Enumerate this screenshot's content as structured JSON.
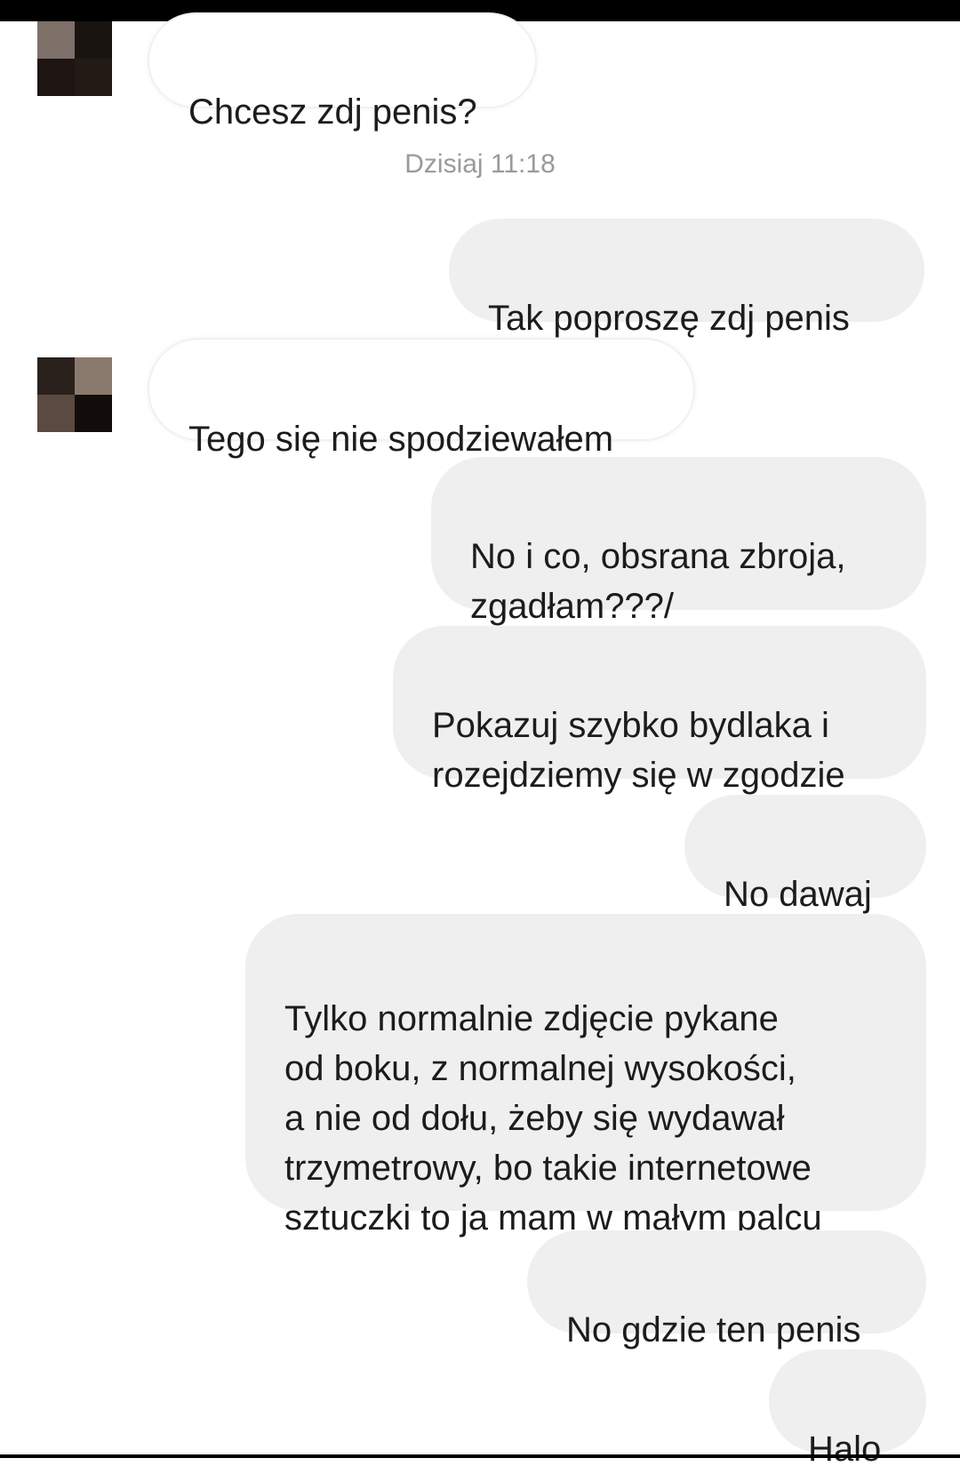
{
  "conversation": {
    "timestamp": "Dzisiaj 11:18",
    "messages": [
      {
        "side": "in",
        "text": "Chcesz zdj penis?"
      },
      {
        "side": "out",
        "text": "Tak poproszę zdj penis"
      },
      {
        "side": "in",
        "text": "Tego się nie spodziewałem"
      },
      {
        "side": "out",
        "text": "No i co, obsrana zbroja,\nzgadłam???/"
      },
      {
        "side": "out",
        "text": "Pokazuj szybko bydlaka i\nrozejdziemy się w zgodzie"
      },
      {
        "side": "out",
        "text": "No dawaj"
      },
      {
        "side": "out",
        "text": "Tylko normalnie zdjęcie pykane\nod boku, z normalnej wysokości,\na nie od dołu, żeby się wydawał\ntrzymetrowy, bo takie internetowe\nsztuczki to ja mam w małym palcu"
      },
      {
        "side": "out",
        "text": "No gdzie ten penis"
      },
      {
        "side": "out",
        "text": "Halo"
      }
    ]
  },
  "avatar": {
    "description_icon": "pixelated-avatar-icon",
    "colors": [
      "#2a211c",
      "#8a7a6d",
      "#5a4a3f",
      "#120d0a"
    ]
  }
}
